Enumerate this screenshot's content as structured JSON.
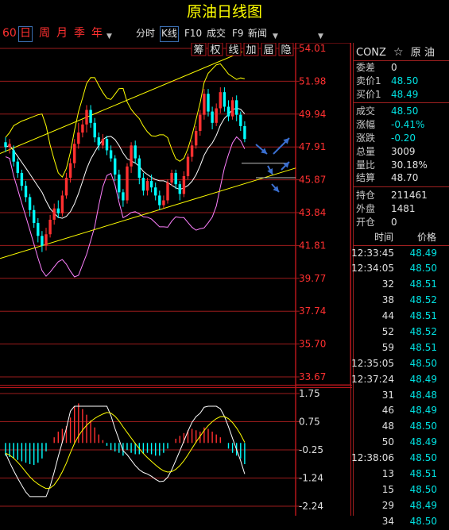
{
  "window": {
    "title": "原油日线图"
  },
  "toolbar": {
    "periods": [
      "60",
      "日",
      "周",
      "月",
      "季",
      "年"
    ],
    "tools": [
      "分时",
      "K线",
      "F10",
      "成交",
      "F9",
      "新闻"
    ]
  },
  "chart_tabs": [
    "筹",
    "权",
    "线",
    "加",
    "届",
    "隐"
  ],
  "main_axis": {
    "labels": [
      "54.01",
      "51.98",
      "49.94",
      "47.91",
      "45.87",
      "43.84",
      "41.81",
      "39.77",
      "37.74",
      "35.70",
      "33.67"
    ]
  },
  "macd_axis": {
    "labels": [
      "1.75",
      "0.75",
      "-0.25",
      "-1.24",
      "-2.24"
    ]
  },
  "colors": {
    "up": "#ff3030",
    "down": "#00ffff",
    "trend": "#ffff00",
    "boll": "#ffffff",
    "lower_band": "#ff80ff",
    "grid": "#9b1c1c",
    "arrow": "#3a6fd0"
  },
  "quote": {
    "symbol": "CONZ",
    "name": "原 油",
    "rows": [
      {
        "label": "委差",
        "value": "0",
        "color": "white"
      },
      {
        "label": "卖价1",
        "value": "48.50",
        "color": "cyan"
      },
      {
        "label": "买价1",
        "value": "48.49",
        "color": "cyan"
      },
      {
        "label": "成交",
        "value": "48.50",
        "color": "cyan"
      },
      {
        "label": "涨幅",
        "value": "-0.41%",
        "color": "cyan"
      },
      {
        "label": "涨跌",
        "value": "-0.20",
        "color": "cyan"
      },
      {
        "label": "总量",
        "value": "3009",
        "color": "white"
      },
      {
        "label": "量比",
        "value": "30.18%",
        "color": "white"
      },
      {
        "label": "结算",
        "value": "48.70",
        "color": "white"
      },
      {
        "label": "持仓",
        "value": "211461",
        "color": "white"
      },
      {
        "label": "外盘",
        "value": "1481",
        "color": "white"
      },
      {
        "label": "开仓",
        "value": "0",
        "color": "white"
      }
    ]
  },
  "ticks": {
    "header": {
      "time": "时间",
      "price": "价格"
    },
    "rows": [
      {
        "time": "12:33:45",
        "price": "48.49"
      },
      {
        "time": "12:34:05",
        "price": "48.50"
      },
      {
        "time": "32",
        "price": "48.51"
      },
      {
        "time": "38",
        "price": "48.52"
      },
      {
        "time": "44",
        "price": "48.51"
      },
      {
        "time": "52",
        "price": "48.52"
      },
      {
        "time": "59",
        "price": "48.51"
      },
      {
        "time": "12:35:05",
        "price": "48.50"
      },
      {
        "time": "12:37:24",
        "price": "48.49"
      },
      {
        "time": "31",
        "price": "48.48"
      },
      {
        "time": "46",
        "price": "48.49"
      },
      {
        "time": "48",
        "price": "48.50"
      },
      {
        "time": "50",
        "price": "48.49"
      },
      {
        "time": "12:38:06",
        "price": "48.50"
      },
      {
        "time": "13",
        "price": "48.51"
      },
      {
        "time": "15",
        "price": "48.50"
      },
      {
        "time": "29",
        "price": "48.49"
      },
      {
        "time": "34",
        "price": "48.50"
      }
    ]
  },
  "chart_data": {
    "type": "candlestick",
    "ylim": [
      33.67,
      54.01
    ],
    "candles": [
      [
        48.2,
        47.9,
        48.5,
        47.6
      ],
      [
        47.9,
        48.1,
        48.4,
        47.5
      ],
      [
        47.7,
        47.0,
        48.0,
        46.7
      ],
      [
        47.0,
        46.3,
        47.2,
        46.0
      ],
      [
        46.3,
        45.5,
        46.5,
        45.2
      ],
      [
        45.5,
        44.8,
        45.8,
        44.5
      ],
      [
        44.8,
        44.0,
        45.0,
        43.6
      ],
      [
        44.0,
        43.2,
        44.3,
        42.9
      ],
      [
        43.2,
        42.4,
        43.5,
        42.0
      ],
      [
        42.4,
        41.8,
        42.7,
        41.4
      ],
      [
        41.8,
        42.5,
        42.9,
        41.5
      ],
      [
        42.5,
        43.4,
        43.7,
        42.3
      ],
      [
        43.4,
        44.1,
        44.4,
        43.1
      ],
      [
        44.1,
        43.8,
        44.6,
        43.5
      ],
      [
        43.8,
        44.9,
        45.2,
        43.6
      ],
      [
        44.9,
        46.0,
        46.3,
        44.7
      ],
      [
        46.0,
        46.9,
        47.2,
        45.7
      ],
      [
        46.9,
        48.1,
        48.4,
        46.6
      ],
      [
        48.1,
        48.8,
        49.4,
        47.8
      ],
      [
        48.8,
        49.3,
        49.6,
        48.5
      ],
      [
        49.3,
        50.2,
        50.5,
        48.8
      ],
      [
        50.2,
        49.4,
        50.5,
        49.1
      ],
      [
        49.4,
        48.5,
        49.7,
        48.2
      ],
      [
        48.5,
        48.0,
        48.8,
        47.7
      ],
      [
        48.0,
        48.4,
        48.7,
        47.8
      ],
      [
        48.4,
        47.7,
        48.6,
        47.4
      ],
      [
        47.7,
        47.2,
        48.0,
        47.0
      ],
      [
        47.2,
        46.2,
        47.4,
        45.8
      ],
      [
        46.2,
        45.1,
        46.5,
        44.7
      ],
      [
        45.1,
        44.6,
        45.3,
        44.2
      ],
      [
        44.6,
        46.7,
        46.9,
        44.4
      ],
      [
        46.7,
        48.0,
        48.2,
        46.3
      ],
      [
        48.0,
        47.2,
        48.3,
        46.9
      ],
      [
        47.2,
        46.0,
        47.4,
        45.6
      ],
      [
        46.0,
        45.2,
        46.3,
        44.9
      ],
      [
        45.2,
        45.8,
        46.0,
        44.9
      ],
      [
        45.8,
        45.4,
        46.2,
        45.1
      ],
      [
        45.4,
        44.9,
        45.7,
        44.6
      ],
      [
        44.9,
        44.3,
        45.2,
        44.0
      ],
      [
        44.3,
        44.6,
        44.9,
        44.1
      ],
      [
        44.6,
        45.7,
        45.9,
        44.4
      ],
      [
        45.7,
        46.3,
        46.5,
        45.5
      ],
      [
        46.3,
        45.6,
        46.5,
        45.3
      ],
      [
        45.6,
        45.0,
        45.8,
        44.6
      ],
      [
        45.0,
        46.1,
        46.4,
        44.8
      ],
      [
        46.1,
        47.3,
        47.5,
        45.9
      ],
      [
        47.3,
        48.0,
        48.3,
        47.0
      ],
      [
        48.0,
        48.9,
        49.2,
        47.8
      ],
      [
        48.9,
        49.9,
        50.2,
        48.6
      ],
      [
        49.9,
        51.2,
        51.5,
        49.6
      ],
      [
        51.2,
        50.1,
        51.5,
        49.8
      ],
      [
        50.1,
        49.4,
        50.4,
        49.0
      ],
      [
        49.4,
        50.3,
        50.6,
        49.2
      ],
      [
        50.3,
        51.3,
        51.6,
        50.0
      ],
      [
        51.3,
        50.4,
        51.6,
        50.1
      ],
      [
        50.4,
        49.8,
        50.8,
        49.5
      ],
      [
        49.8,
        50.8,
        51.0,
        49.6
      ],
      [
        50.8,
        49.9,
        51.1,
        49.5
      ],
      [
        49.9,
        49.2,
        50.1,
        48.9
      ],
      [
        49.2,
        48.4,
        49.5,
        48.2
      ]
    ],
    "macd": [
      -0.45,
      -0.5,
      -0.55,
      -0.6,
      -0.65,
      -0.7,
      -0.75,
      -0.78,
      -0.7,
      -0.55,
      -0.3,
      0.0,
      0.2,
      0.4,
      0.5,
      0.6,
      0.9,
      1.3,
      1.4,
      1.2,
      1.0,
      0.8,
      0.55,
      0.3,
      0.1,
      -0.1,
      -0.25,
      -0.3,
      -0.35,
      -0.45,
      -0.25,
      -0.35,
      -0.4,
      -0.4,
      -0.38,
      -0.35,
      -0.4,
      -0.45,
      -0.45,
      -0.35,
      -0.2,
      0.0,
      0.15,
      0.25,
      0.35,
      0.45,
      0.5,
      0.45,
      0.4,
      0.55,
      0.5,
      0.4,
      0.3,
      0.2,
      0.0,
      -0.2,
      -0.35,
      -0.45,
      -0.55,
      -0.75
    ],
    "macd_ylim": [
      -2.24,
      1.75
    ]
  }
}
